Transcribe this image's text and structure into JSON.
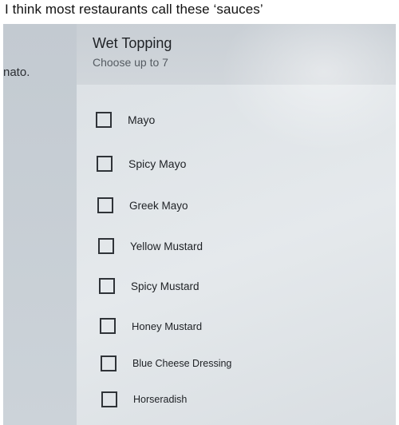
{
  "post": {
    "caption": "I think most restaurants call these ‘sauces’"
  },
  "screen": {
    "left_partial_text": "nato.",
    "section": {
      "title": "Wet Topping",
      "subtitle": "Choose up to 7"
    },
    "options": [
      {
        "label": "Mayo",
        "checked": false
      },
      {
        "label": "Spicy Mayo",
        "checked": false
      },
      {
        "label": "Greek Mayo",
        "checked": false
      },
      {
        "label": "Yellow Mustard",
        "checked": false
      },
      {
        "label": "Spicy Mustard",
        "checked": false
      },
      {
        "label": "Honey Mustard",
        "checked": false
      },
      {
        "label": "Blue Cheese Dressing",
        "checked": false
      },
      {
        "label": "Horseradish",
        "checked": false
      }
    ]
  }
}
